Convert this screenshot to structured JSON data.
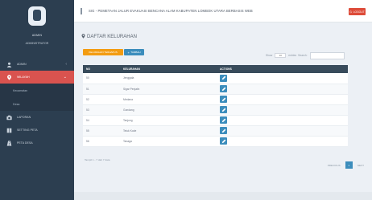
{
  "sidebar": {
    "brand_name": "ADMIN",
    "brand_sub": "ADMINISTRATOR",
    "items": [
      {
        "label": "ADMIN",
        "icon": "user-icon"
      },
      {
        "label": "WILAYAH",
        "icon": "location-pin-icon"
      },
      {
        "label": "Kecamatan",
        "icon": ""
      },
      {
        "label": "Desa",
        "icon": ""
      },
      {
        "label": "LAPORAN",
        "icon": "camera-icon"
      },
      {
        "label": "SETTING PETA",
        "icon": "book-icon"
      },
      {
        "label": "PETA DESA",
        "icon": "road-icon"
      }
    ]
  },
  "topbar": {
    "title": "SIG - PEMETAAN JALUR EVAKUASI BENCANA ALAM KABUPATEN LOMBOK UTARA BERBASIS WEB",
    "logout_label": "LOGOUT"
  },
  "main": {
    "heading": "DAFTAR KELURAHAN",
    "btn_orange": "KELURAHAN TERHAPUS",
    "btn_add": "TAMBAH",
    "filter_show": "Show",
    "filter_entries": "entries",
    "filter_search": "Search:",
    "select_value": "10"
  },
  "table": {
    "headers": [
      "NO",
      "KELURAHAN",
      "ACTIONS"
    ],
    "rows": [
      {
        "no": "50",
        "name": "Jenggala"
      },
      {
        "no": "51",
        "name": "Sigar Penjalin"
      },
      {
        "no": "52",
        "name": "Medana"
      },
      {
        "no": "53",
        "name": "Gondang"
      },
      {
        "no": "54",
        "name": "Tanjung"
      },
      {
        "no": "55",
        "name": "Teluk Kode"
      },
      {
        "no": "56",
        "name": "Tanaga"
      }
    ],
    "info": "Tampil 1 - 7 dari 7 data",
    "prev": "PREVIOUS",
    "page": "1",
    "next": "NEXT"
  },
  "colors": {
    "sidebar": "#2c3e50",
    "accent_red": "#d9534f",
    "accent_blue": "#3c8dbc",
    "accent_orange": "#f39c12",
    "table_header": "#384b5b"
  }
}
